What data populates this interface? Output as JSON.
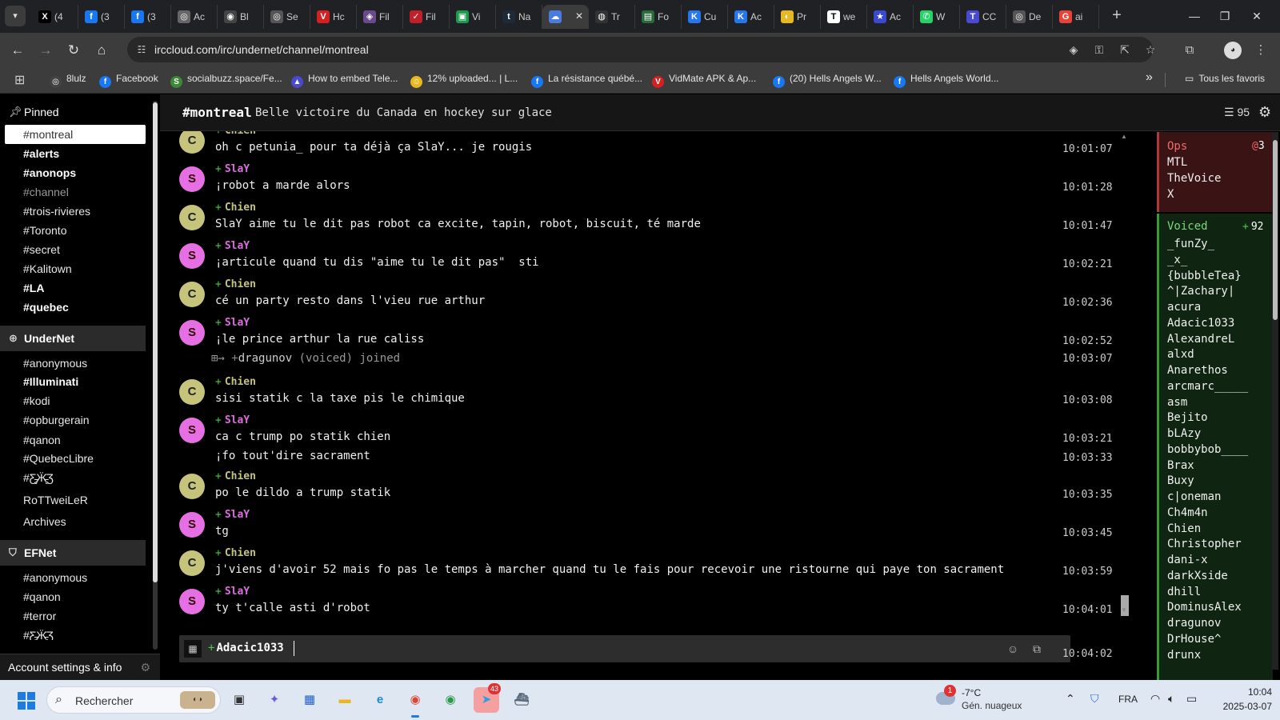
{
  "browser": {
    "tabs": [
      {
        "icon": "x-icon",
        "label": "(4",
        "color": "#000000",
        "glyph": "X"
      },
      {
        "icon": "facebook-icon",
        "label": "(3",
        "color": "#1877f2",
        "glyph": "f"
      },
      {
        "icon": "facebook-icon",
        "label": "(3",
        "color": "#1877f2",
        "glyph": "f"
      },
      {
        "icon": "globe-icon",
        "label": "Ac",
        "color": "#666666",
        "glyph": "◎"
      },
      {
        "icon": "generic-icon",
        "label": "Bl",
        "color": "#444444",
        "glyph": "◉"
      },
      {
        "icon": "generic-icon",
        "label": "Se",
        "color": "#555555",
        "glyph": "◎"
      },
      {
        "icon": "shield-icon",
        "label": "Hc",
        "color": "#d42020",
        "glyph": "V"
      },
      {
        "icon": "generic-icon",
        "label": "Fil",
        "color": "#6a4a8a",
        "glyph": "◈"
      },
      {
        "icon": "swoosh-icon",
        "label": "Fil",
        "color": "#c0202a",
        "glyph": "✓"
      },
      {
        "icon": "generic-icon",
        "label": "Vi",
        "color": "#1a9a4a",
        "glyph": "▣"
      },
      {
        "icon": "tumblr-icon",
        "label": "Na",
        "color": "#1d2a3a",
        "glyph": "t"
      },
      {
        "icon": "irccloud-icon",
        "label": "",
        "color": "#4a7bdd",
        "glyph": "☁",
        "active": true
      },
      {
        "icon": "generic-icon",
        "label": "Tr",
        "color": "#333333",
        "glyph": "◍"
      },
      {
        "icon": "generic-icon",
        "label": "Fo",
        "color": "#2a6a3a",
        "glyph": "▤"
      },
      {
        "icon": "vk-icon",
        "label": "Cu",
        "color": "#2677ee",
        "glyph": "K"
      },
      {
        "icon": "vk-icon",
        "label": "Ac",
        "color": "#2677ee",
        "glyph": "K"
      },
      {
        "icon": "generic-icon",
        "label": "Pr",
        "color": "#e8b820",
        "glyph": "◐"
      },
      {
        "icon": "generic-icon",
        "label": "we",
        "color": "#ffffff",
        "glyph": "T"
      },
      {
        "icon": "star-icon",
        "label": "Ac",
        "color": "#3a4ad0",
        "glyph": "★"
      },
      {
        "icon": "whatsapp-icon",
        "label": "W",
        "color": "#25d366",
        "glyph": "✆"
      },
      {
        "icon": "generic-icon",
        "label": "CC",
        "color": "#4a4ad0",
        "glyph": "T"
      },
      {
        "icon": "generic-icon",
        "label": "De",
        "color": "#555555",
        "glyph": "◎"
      },
      {
        "icon": "google-icon",
        "label": "ai",
        "color": "#ea4335",
        "glyph": "G"
      }
    ],
    "url": "irccloud.com/irc/undernet/channel/montreal",
    "bookmarks": [
      {
        "icon": "8lulz-icon",
        "label": "8lulz",
        "color": "#444444",
        "glyph": "◎"
      },
      {
        "icon": "facebook-icon",
        "label": "Facebook",
        "color": "#1877f2",
        "glyph": "f"
      },
      {
        "icon": "socialbuzz-icon",
        "label": "socialbuzz.space/Fe...",
        "color": "#3a8a3a",
        "glyph": "S"
      },
      {
        "icon": "telegram-icon",
        "label": "How to embed Tele...",
        "color": "#4a4ad0",
        "glyph": "▲"
      },
      {
        "icon": "emoji-icon",
        "label": "12% uploaded... | L...",
        "color": "#e8b820",
        "glyph": "☺"
      },
      {
        "icon": "facebook-icon",
        "label": "La résistance québé...",
        "color": "#1877f2",
        "glyph": "f"
      },
      {
        "icon": "vidmate-icon",
        "label": "VidMate APK & Ap...",
        "color": "#d42020",
        "glyph": "V"
      },
      {
        "icon": "facebook-icon",
        "label": "(20) Hells Angels W...",
        "color": "#1877f2",
        "glyph": "f"
      },
      {
        "icon": "facebook-icon",
        "label": "Hells Angels World...",
        "color": "#1877f2",
        "glyph": "f"
      }
    ],
    "all_bookmarks_label": "Tous les favoris"
  },
  "sidebar": {
    "pinned_label": "Pinned",
    "pinned": [
      {
        "label": "#montreal",
        "style": "active"
      },
      {
        "label": "#alerts",
        "style": "bold unread"
      },
      {
        "label": "#anonops",
        "style": "bold unread"
      },
      {
        "label": "#channel",
        "style": "dim"
      },
      {
        "label": "#trois-rivieres",
        "style": ""
      },
      {
        "label": "#Toronto",
        "style": ""
      },
      {
        "label": "#secret",
        "style": ""
      },
      {
        "label": "#Kalitown",
        "style": ""
      },
      {
        "label": "#LA",
        "style": "bold unread"
      },
      {
        "label": "#quebec",
        "style": "bold unread"
      }
    ],
    "undernet_label": "UnderNet",
    "undernet": [
      {
        "label": "#anonymous",
        "style": ""
      },
      {
        "label": "#Illuminati",
        "style": "bold unread"
      },
      {
        "label": "#kodi",
        "style": ""
      },
      {
        "label": "#opburgerain",
        "style": ""
      },
      {
        "label": "#qanon",
        "style": ""
      },
      {
        "label": "#QuebecLibre",
        "style": ""
      },
      {
        "label": "#Ƹ̵̡Ӝ̵̨̄Ʒ",
        "style": ""
      },
      {
        "label": "RoTTweiLeR",
        "style": ""
      },
      {
        "label": "Archives",
        "style": ""
      }
    ],
    "efnet_label": "EFNet",
    "efnet": [
      {
        "label": "#anonymous",
        "style": ""
      },
      {
        "label": "#qanon",
        "style": ""
      },
      {
        "label": "#terror",
        "style": ""
      },
      {
        "label": "#Ƹ̵̡Ӝ̵̨̄Ʒ",
        "style": ""
      }
    ],
    "account_label": "Account settings & info"
  },
  "channel": {
    "name": "#montreal",
    "topic": "Belle victoire du Canada en hockey sur glace",
    "user_count": "95"
  },
  "messages": [
    {
      "kind": "msg",
      "nick": "Chien",
      "who": "c",
      "text": "oh c petunia_ pour ta déjà ça SlaY... je rougis",
      "time": "10:01:07",
      "partial": true
    },
    {
      "kind": "msg",
      "nick": "SlaY",
      "who": "s",
      "text": "¡robot a marde alors",
      "time": "10:01:28"
    },
    {
      "kind": "msg",
      "nick": "Chien",
      "who": "c",
      "text": "SlaY aime tu le dit pas robot ca excite, tapin, robot, biscuit, té marde",
      "time": "10:01:47"
    },
    {
      "kind": "msg",
      "nick": "SlaY",
      "who": "s",
      "text": "¡articule quand tu dis \"aime tu le dit pas\"  sti",
      "time": "10:02:21"
    },
    {
      "kind": "msg",
      "nick": "Chien",
      "who": "c",
      "text": "cé un party resto dans l'vieu rue arthur",
      "time": "10:02:36"
    },
    {
      "kind": "msg",
      "nick": "SlaY",
      "who": "s",
      "text": "¡le prince arthur la rue caliss",
      "time": "10:02:52"
    },
    {
      "kind": "join",
      "nick": "dragunov",
      "mode": "(voiced)",
      "action": "joined",
      "time": "10:03:07"
    },
    {
      "kind": "msg",
      "nick": "Chien",
      "who": "c",
      "text": "sisi statik c la taxe pis le chimique",
      "time": "10:03:08"
    },
    {
      "kind": "msg",
      "nick": "SlaY",
      "who": "s",
      "text": "ca c trump po statik chien",
      "time": "10:03:21"
    },
    {
      "kind": "cont",
      "who": "s",
      "text": "¡fo tout'dire sacrament",
      "time": "10:03:33"
    },
    {
      "kind": "msg",
      "nick": "Chien",
      "who": "c",
      "text": "po le dildo a trump statik",
      "time": "10:03:35"
    },
    {
      "kind": "msg",
      "nick": "SlaY",
      "who": "s",
      "text": "tg",
      "time": "10:03:45"
    },
    {
      "kind": "msg",
      "nick": "Chien",
      "who": "c",
      "text": "j'viens d'avoir 52 mais fo pas le temps à marcher quand tu le fais pour recevoir une ristourne qui paye ton sacrament",
      "time": "10:03:59"
    },
    {
      "kind": "msg",
      "nick": "SlaY",
      "who": "s",
      "text": "ty t'calle asti d'robot",
      "time": "10:04:01"
    }
  ],
  "input": {
    "nick": "Adacic1033",
    "time": "10:04:02"
  },
  "members": {
    "ops_label": "Ops",
    "ops_count": "3",
    "ops": [
      "MTL",
      "TheVoice",
      "X"
    ],
    "voiced_label": "Voiced",
    "voiced_count": "92",
    "voiced": [
      "_funZy_",
      "_x_",
      "{bubbleTea}",
      "^|Zachary|",
      "acura",
      "Adacic1033",
      "AlexandreL",
      "alxd",
      "Anarethos",
      "arcmarc_____",
      "asm",
      "Bejito",
      "bLAzy",
      "bobbybob____",
      "Brax",
      "Buxy",
      "c|oneman",
      "Ch4m4n",
      "Chien",
      "Christopher",
      "dani-x",
      "darkXside",
      "dhill",
      "DominusAlex",
      "dragunov",
      "DrHouse^",
      "drunx"
    ]
  },
  "taskbar": {
    "search_placeholder": "Rechercher",
    "apps": [
      {
        "icon": "taskview-icon",
        "color": "#333333",
        "glyph": "▣"
      },
      {
        "icon": "copilot-icon",
        "color": "#6a5ae0",
        "glyph": "✦"
      },
      {
        "icon": "store-icon",
        "color": "#1e5fd0",
        "glyph": "▦"
      },
      {
        "icon": "explorer-icon",
        "color": "#e8b820",
        "glyph": "▬"
      },
      {
        "icon": "edge-icon",
        "color": "#1a8ad8",
        "glyph": "e"
      },
      {
        "icon": "chrome-icon",
        "color": "#dd4433",
        "glyph": "◉",
        "active": true
      },
      {
        "icon": "chrome-profile-icon",
        "color": "#2a9a4a",
        "glyph": "◉"
      },
      {
        "icon": "telegram-icon",
        "color": "#2aa0e0",
        "glyph": "➤",
        "badge": "43",
        "highlight": true
      },
      {
        "icon": "ship-icon",
        "color": "#556677",
        "glyph": "⛴"
      }
    ],
    "weather_badge": "1",
    "temperature": "-7°C",
    "condition": "Gén. nuageux",
    "language": "FRA",
    "time": "10:04",
    "date": "2025-03-07"
  }
}
